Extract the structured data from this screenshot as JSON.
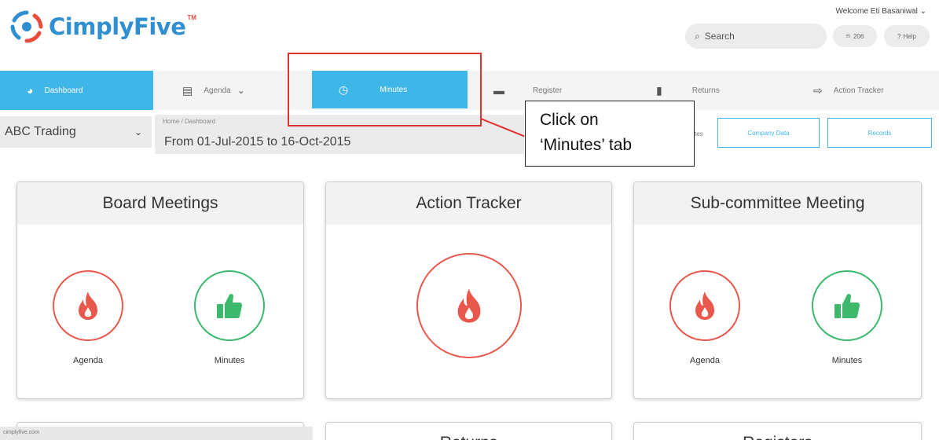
{
  "brand": {
    "name": "CimplyFive",
    "tm": "TM"
  },
  "header": {
    "welcome": "Welcome Eti Basaniwal",
    "search_label": "Search",
    "notif_count": "206",
    "help_label": "Help"
  },
  "nav": {
    "items": [
      {
        "label": "Dashboard"
      },
      {
        "label": "Agenda"
      },
      {
        "label": "Minutes"
      },
      {
        "label": "Register"
      },
      {
        "label": "Returns"
      },
      {
        "label": "Action Tracker"
      }
    ]
  },
  "subheader": {
    "company": "ABC Trading",
    "breadcrumb": "Home / Dashboard",
    "daterange": "From 01-Jul-2015 to 16-Oct-2015",
    "partial_text": "tes",
    "company_data_button": "Company Data",
    "records_button": "Records"
  },
  "callout": {
    "line1": "Click on",
    "line2": "‘Minutes’ tab"
  },
  "cards": [
    {
      "title": "Board Meetings",
      "left_label": "Agenda",
      "right_label": "Minutes"
    },
    {
      "title": "Action Tracker"
    },
    {
      "title": "Sub-committee Meeting",
      "left_label": "Agenda",
      "right_label": "Minutes"
    }
  ],
  "bottom_cards": [
    {
      "title": ""
    },
    {
      "title": "Returns"
    },
    {
      "title": "Registers"
    }
  ],
  "status_bar": {
    "url": "cimplyfive.com"
  },
  "colors": {
    "accent": "#3fb6e8",
    "brand_blue": "#2f8fd0",
    "alert_red": "#e8584c",
    "success_green": "#3cb96d",
    "callout_red": "#e03131"
  },
  "icons": {
    "dashboard": "dashboard-icon",
    "agenda": "list-icon",
    "minutes": "clock-icon",
    "register": "folder-icon",
    "returns": "document-icon",
    "tracker": "export-icon",
    "agenda_card": "flame-icon",
    "minutes_card": "thumbs-up-icon"
  }
}
